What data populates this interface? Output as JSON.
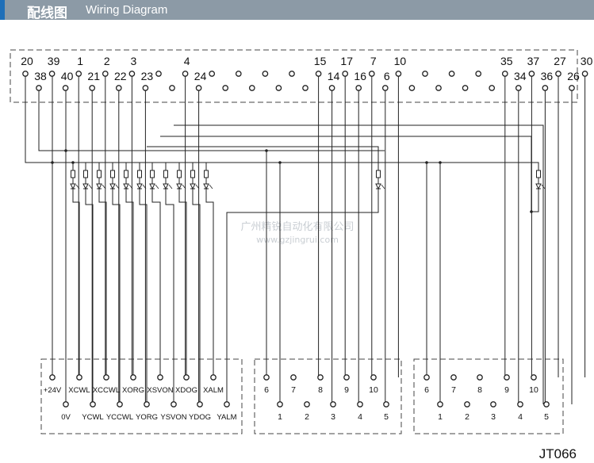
{
  "header": {
    "title_cn": "配线图",
    "title_en": "Wiring Diagram"
  },
  "top_connector": {
    "upper_row": [
      "20",
      "39",
      "1",
      "2",
      "3",
      "",
      "4",
      "",
      "",
      "",
      "",
      "15",
      "17",
      "7",
      "10",
      "",
      "",
      "",
      "35",
      "37",
      "27",
      "30",
      "",
      ""
    ],
    "lower_row": [
      "38",
      "40",
      "21",
      "22",
      "23",
      "",
      "24",
      "",
      "",
      "",
      "",
      "14",
      "16",
      "6",
      "",
      "",
      "",
      "",
      "34",
      "36",
      "26",
      "",
      "",
      ""
    ]
  },
  "terminal_block_1": {
    "upper_labels": [
      "+24V",
      "XCWL",
      "XCCWL",
      "XORG",
      "XSVON",
      "XDOG",
      "XALM"
    ],
    "lower_labels": [
      "0V",
      "YCWL",
      "YCCWL",
      "YORG",
      "YSVON",
      "YDOG",
      "YALM"
    ]
  },
  "terminal_block_2": {
    "upper_labels": [
      "6",
      "7",
      "8",
      "9",
      "10"
    ],
    "lower_labels": [
      "1",
      "2",
      "3",
      "4",
      "5"
    ]
  },
  "terminal_block_3": {
    "upper_labels": [
      "6",
      "7",
      "8",
      "9",
      "10"
    ],
    "lower_labels": [
      "1",
      "2",
      "3",
      "4",
      "5"
    ]
  },
  "watermark": {
    "line1": "广州精锐自动化有限公司",
    "line2": "www.gzjingrui.com"
  },
  "model": "JT066"
}
